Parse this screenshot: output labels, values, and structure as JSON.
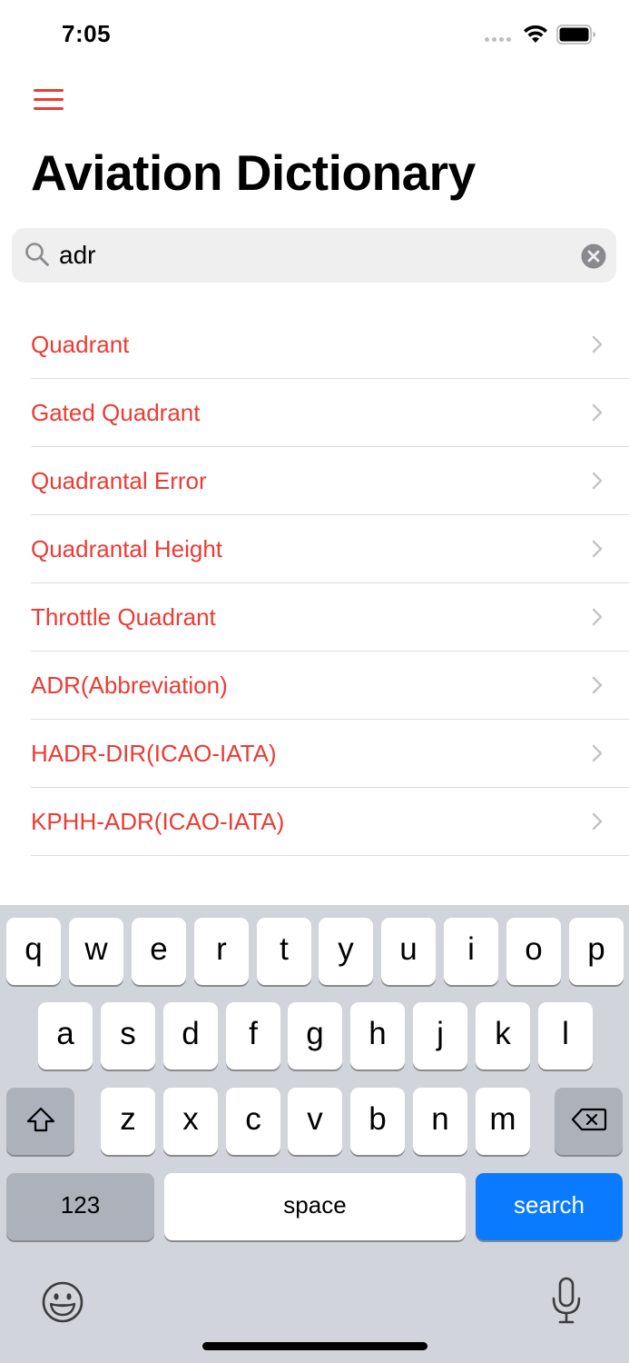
{
  "status_bar": {
    "time": "7:05",
    "icons": [
      "signal-dots",
      "wifi-icon",
      "battery-icon"
    ]
  },
  "header": {
    "menu_icon": "hamburger-menu-icon",
    "title": "Aviation Dictionary"
  },
  "search": {
    "value": "adr",
    "placeholder": "",
    "icon": "search-icon",
    "clear_icon": "clear-icon"
  },
  "results": [
    "Quadrant",
    "Gated Quadrant",
    "Quadrantal Error",
    "Quadrantal Height",
    "Throttle Quadrant",
    "ADR(Abbreviation)",
    "HADR-DIR(ICAO-IATA)",
    "KPHH-ADR(ICAO-IATA)"
  ],
  "keyboard": {
    "row1": [
      "q",
      "w",
      "e",
      "r",
      "t",
      "y",
      "u",
      "i",
      "o",
      "p"
    ],
    "row2": [
      "a",
      "s",
      "d",
      "f",
      "g",
      "h",
      "j",
      "k",
      "l"
    ],
    "row3": [
      "z",
      "x",
      "c",
      "v",
      "b",
      "n",
      "m"
    ],
    "numbers_label": "123",
    "space_label": "space",
    "search_label": "search",
    "icons": [
      "shift-icon",
      "delete-icon",
      "emoji-icon",
      "microphone-icon"
    ]
  },
  "colors": {
    "accent": "#ec3b33",
    "search_key": "#0a7aff",
    "keyboard_bg": "#d1d4da",
    "search_bar_bg": "#efeff0"
  }
}
